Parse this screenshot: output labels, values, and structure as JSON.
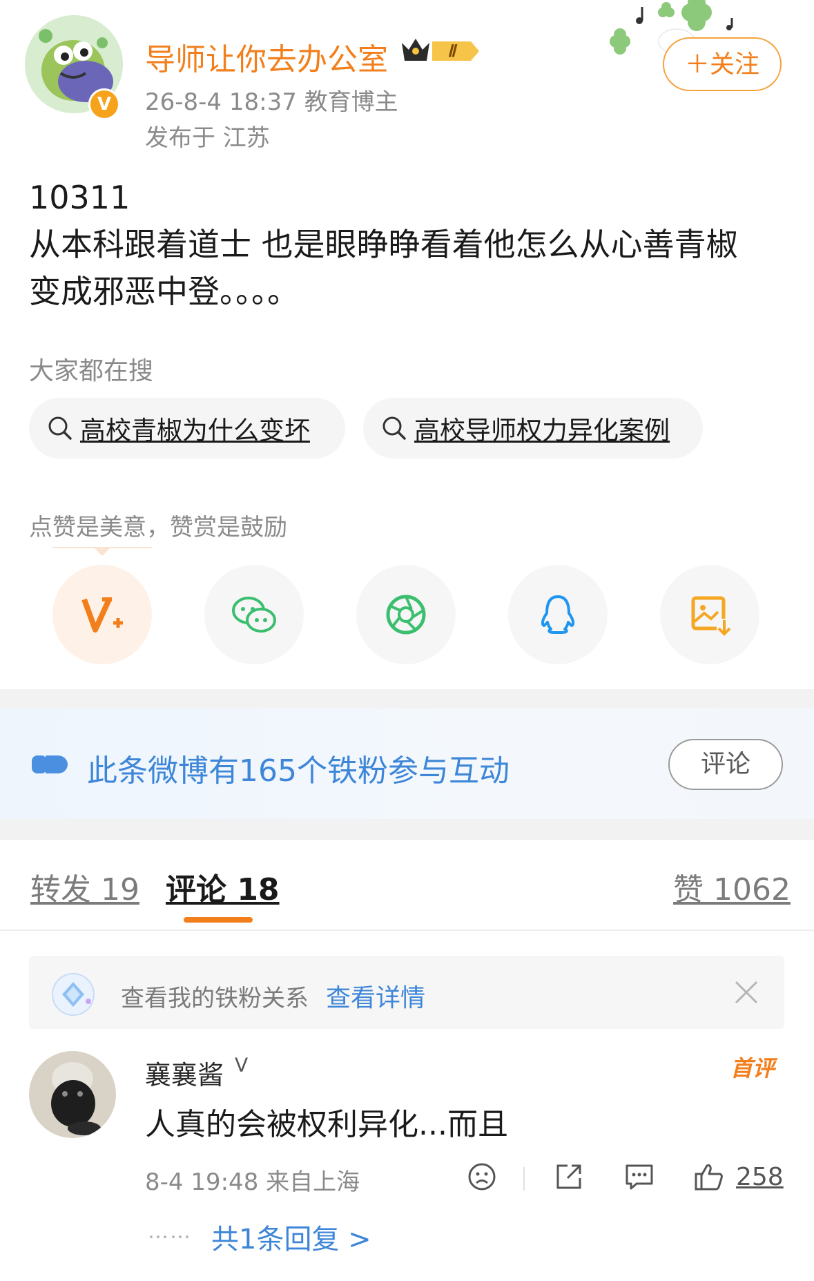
{
  "post": {
    "author": "导师让你去办公室",
    "level_badge": "Ⅱ",
    "verified_badge": "V",
    "time_and_role": "26-8-4 18:37  教育博主",
    "location": "发布于 江苏",
    "follow_label": "＋关注",
    "text_line1": "10311",
    "text_line2": "从本科跟着道士 也是眼睁睁看着他怎么从心善青椒",
    "text_line3": "变成邪恶中登。。。。"
  },
  "search": {
    "header": "大家都在搜",
    "chips": [
      "高校青椒为什么变坏",
      "高校导师权力异化案例"
    ]
  },
  "share": {
    "hint": "点赞是美意，赞赏是鼓励",
    "icons": [
      "vplus-icon",
      "wechat-icon",
      "moments-icon",
      "qq-icon",
      "save-image-icon"
    ],
    "colors": {
      "vplus": "#f27f1b",
      "wechat": "#3bbf6f",
      "moments": "#3bbf6f",
      "qq": "#1f96f0",
      "save": "#f5a623"
    }
  },
  "fan_banner": {
    "text": "此条微博有165个铁粉参与互动",
    "button": "评论"
  },
  "tabs": {
    "forward": "转发 19",
    "comments": "评论 18",
    "likes": "赞 1062"
  },
  "fan_relation": {
    "text": "查看我的铁粉关系",
    "link": "查看详情"
  },
  "comment": {
    "user": "襄襄酱",
    "user_suffix": "ᐯ",
    "badge": "首评",
    "text": "人真的会被权利异化...而且",
    "meta": "8-4 19:48  来自上海",
    "likes": "258",
    "dots": "……",
    "reply_link": "共1条回复 >"
  },
  "colors": {
    "accent_orange": "#f27f1b",
    "link_blue": "#3e86d8"
  }
}
